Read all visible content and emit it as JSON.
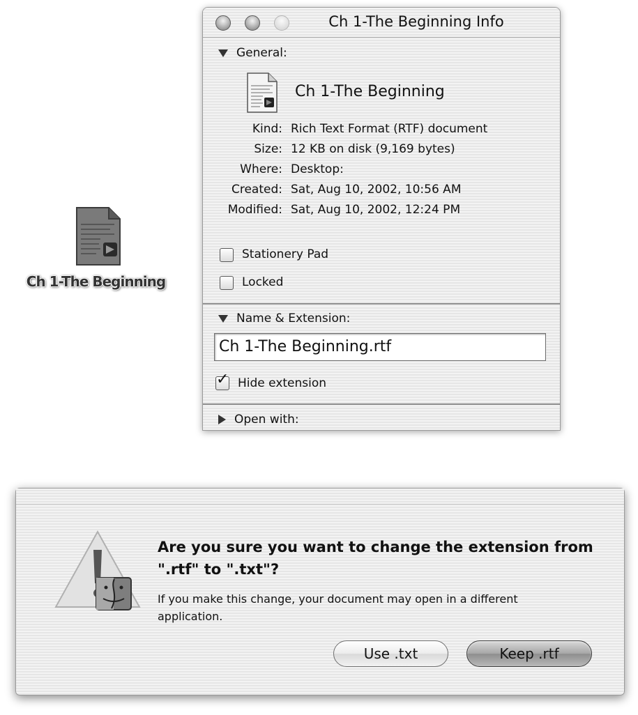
{
  "desktop": {
    "icon_label": "Ch 1-The Beginning",
    "icon_name": "rtf-document-icon"
  },
  "info_window": {
    "title": "Ch 1-The Beginning Info",
    "general": {
      "header": "General:",
      "file_name": "Ch 1-The Beginning",
      "kind_label": "Kind:",
      "kind_value": "Rich Text Format (RTF) document",
      "size_label": "Size:",
      "size_value": "12 KB on disk (9,169 bytes)",
      "where_label": "Where:",
      "where_value": "Desktop:",
      "created_label": "Created:",
      "created_value": "Sat, Aug 10, 2002, 10:56 AM",
      "modified_label": "Modified:",
      "modified_value": "Sat, Aug 10, 2002, 12:24 PM",
      "stationery_label": "Stationery Pad",
      "stationery_checked": false,
      "locked_label": "Locked",
      "locked_checked": false
    },
    "name_extension": {
      "header": "Name & Extension:",
      "field_value": "Ch 1-The Beginning.rtf",
      "hide_extension_label": "Hide extension",
      "hide_extension_checked": true
    },
    "open_with": {
      "header": "Open with:"
    }
  },
  "alert": {
    "title": "Are you sure you want to change the extension from \".rtf\" to \".txt\"?",
    "message": "If you make this change, your document may open in a different application.",
    "secondary_button": "Use .txt",
    "default_button": "Keep .rtf",
    "icon_name": "caution-finder-icon"
  }
}
